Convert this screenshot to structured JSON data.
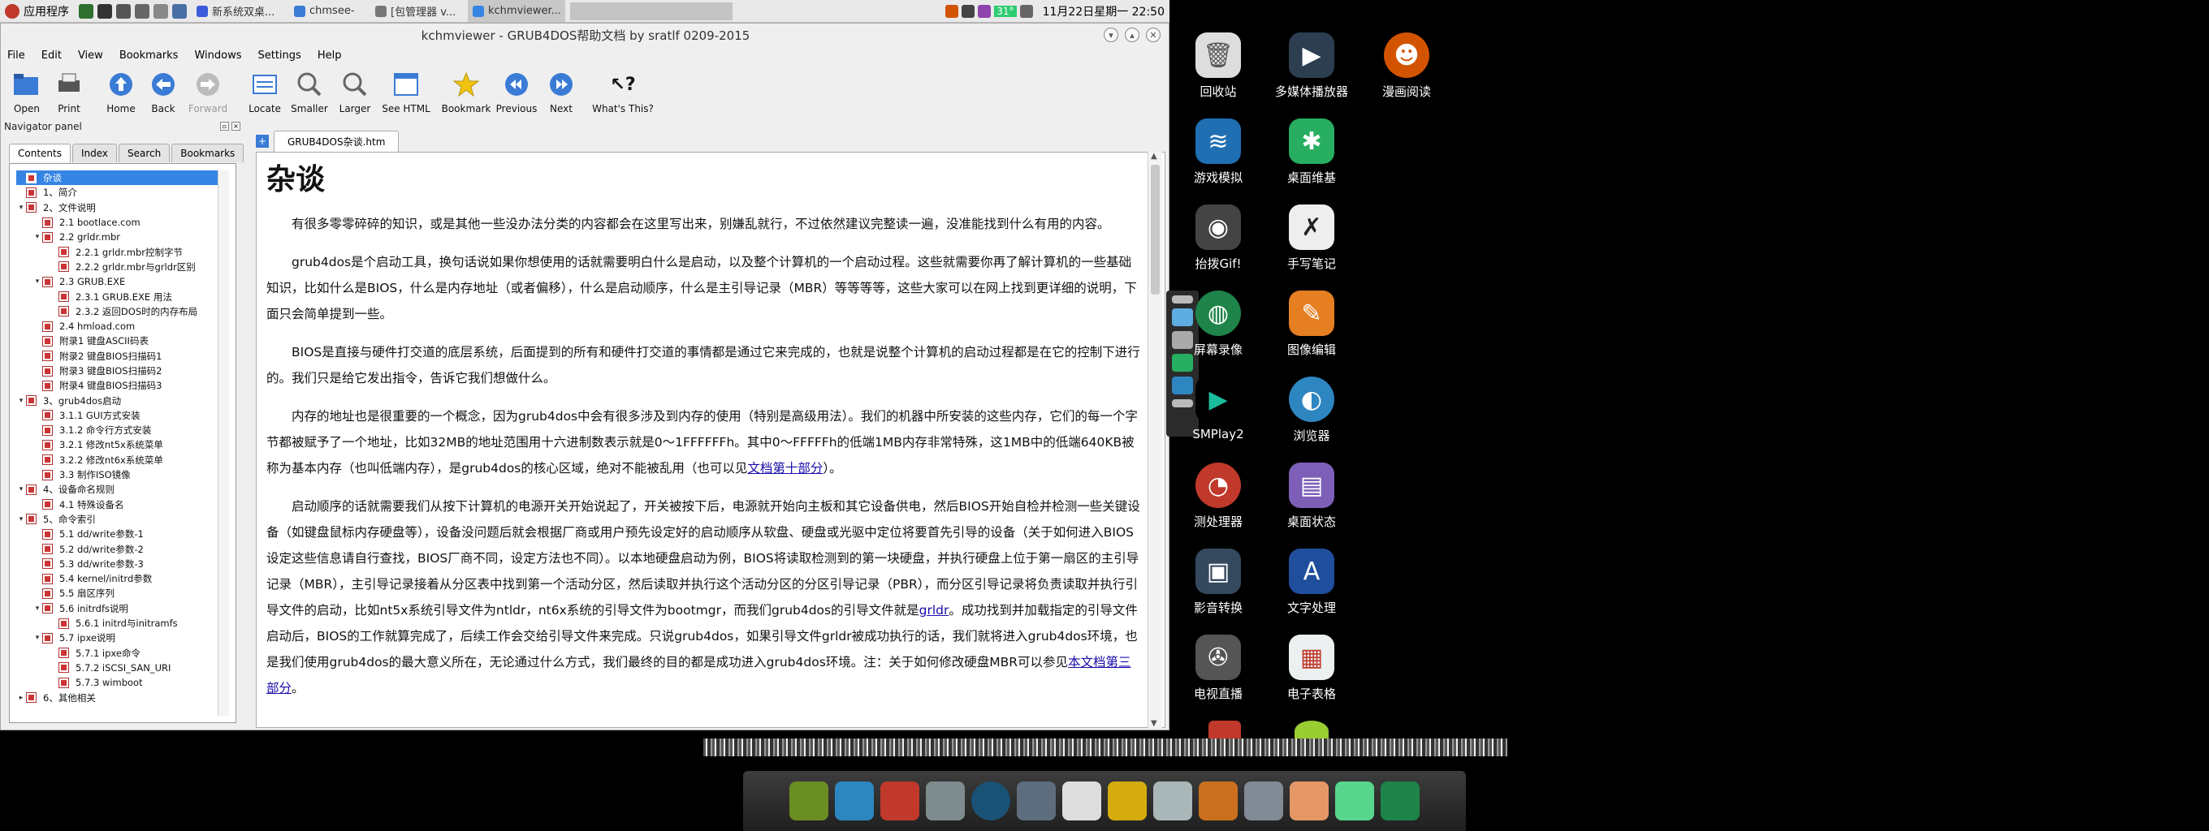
{
  "panel": {
    "app_menu": "应用程序",
    "tasks": [
      "新系统双桌...",
      "chmsee-",
      "[包管理器 v...",
      "kchmviewer..."
    ],
    "tray_battery": "31°",
    "clock": "11月22日星期一 22:50"
  },
  "window": {
    "title": "kchmviewer - GRUB4DOS帮助文档 by sratlf 0209-2015",
    "menu": [
      "File",
      "Edit",
      "View",
      "Bookmarks",
      "Windows",
      "Settings",
      "Help"
    ],
    "toolbar": [
      {
        "label": "Open",
        "icon": "folder-open-icon",
        "enabled": true
      },
      {
        "label": "Print",
        "icon": "printer-icon",
        "enabled": true
      },
      {
        "label": "Home",
        "icon": "home-arrow-icon",
        "enabled": true
      },
      {
        "label": "Back",
        "icon": "back-arrow-icon",
        "enabled": true
      },
      {
        "label": "Forward",
        "icon": "forward-arrow-icon",
        "enabled": false
      },
      {
        "label": "Locate",
        "icon": "locate-icon",
        "enabled": true
      },
      {
        "label": "Smaller",
        "icon": "zoom-out-icon",
        "enabled": true
      },
      {
        "label": "Larger",
        "icon": "zoom-in-icon",
        "enabled": true
      },
      {
        "label": "See HTML",
        "icon": "html-source-icon",
        "enabled": true
      },
      {
        "label": "Bookmark",
        "icon": "star-icon",
        "enabled": true
      },
      {
        "label": "Previous",
        "icon": "previous-icon",
        "enabled": true
      },
      {
        "label": "Next",
        "icon": "next-icon",
        "enabled": true
      },
      {
        "label": "What's This?",
        "icon": "whats-this-icon",
        "enabled": true
      }
    ]
  },
  "navigator": {
    "title": "Navigator panel",
    "tabs": [
      "Contents",
      "Index",
      "Search",
      "Bookmarks"
    ],
    "active_tab": "Contents",
    "tree": [
      {
        "label": "杂谈",
        "level": 0,
        "arrow": "",
        "selected": true
      },
      {
        "label": "1、简介",
        "level": 0,
        "arrow": ""
      },
      {
        "label": "2、文件说明",
        "level": 0,
        "arrow": "▾"
      },
      {
        "label": "2.1 bootlace.com",
        "level": 1,
        "arrow": ""
      },
      {
        "label": "2.2 grldr.mbr",
        "level": 1,
        "arrow": "▾"
      },
      {
        "label": "2.2.1 grldr.mbr控制字节",
        "level": 2,
        "arrow": ""
      },
      {
        "label": "2.2.2 grldr.mbr与grldr区别",
        "level": 2,
        "arrow": ""
      },
      {
        "label": "2.3 GRUB.EXE",
        "level": 1,
        "arrow": "▾"
      },
      {
        "label": "2.3.1 GRUB.EXE 用法",
        "level": 2,
        "arrow": ""
      },
      {
        "label": "2.3.2 返回DOS时的内存布局",
        "level": 2,
        "arrow": ""
      },
      {
        "label": "2.4 hmload.com",
        "level": 1,
        "arrow": ""
      },
      {
        "label": "附录1 键盘ASCII码表",
        "level": 1,
        "arrow": ""
      },
      {
        "label": "附录2 键盘BIOS扫描码1",
        "level": 1,
        "arrow": ""
      },
      {
        "label": "附录3 键盘BIOS扫描码2",
        "level": 1,
        "arrow": ""
      },
      {
        "label": "附录4 键盘BIOS扫描码3",
        "level": 1,
        "arrow": ""
      },
      {
        "label": "3、grub4dos启动",
        "level": 0,
        "arrow": "▾"
      },
      {
        "label": "3.1.1 GUI方式安装",
        "level": 1,
        "arrow": ""
      },
      {
        "label": "3.1.2 命令行方式安装",
        "level": 1,
        "arrow": ""
      },
      {
        "label": "3.2.1 修改nt5x系统菜单",
        "level": 1,
        "arrow": ""
      },
      {
        "label": "3.2.2 修改nt6x系统菜单",
        "level": 1,
        "arrow": ""
      },
      {
        "label": "3.3 制作ISO镜像",
        "level": 1,
        "arrow": ""
      },
      {
        "label": "4、设备命名规则",
        "level": 0,
        "arrow": "▾"
      },
      {
        "label": "4.1 特殊设备名",
        "level": 1,
        "arrow": ""
      },
      {
        "label": "5、命令索引",
        "level": 0,
        "arrow": "▾"
      },
      {
        "label": "5.1 dd/write参数-1",
        "level": 1,
        "arrow": ""
      },
      {
        "label": "5.2 dd/write参数-2",
        "level": 1,
        "arrow": ""
      },
      {
        "label": "5.3 dd/write参数-3",
        "level": 1,
        "arrow": ""
      },
      {
        "label": "5.4 kernel/initrd参数",
        "level": 1,
        "arrow": ""
      },
      {
        "label": "5.5 扇区序列",
        "level": 1,
        "arrow": ""
      },
      {
        "label": "5.6 initrdfs说明",
        "level": 1,
        "arrow": "▾"
      },
      {
        "label": "5.6.1 initrd与initramfs",
        "level": 2,
        "arrow": ""
      },
      {
        "label": "5.7 ipxe说明",
        "level": 1,
        "arrow": "▾"
      },
      {
        "label": "5.7.1 ipxe命令",
        "level": 2,
        "arrow": ""
      },
      {
        "label": "5.7.2 iSCSI_SAN_URI",
        "level": 2,
        "arrow": ""
      },
      {
        "label": "5.7.3 wimboot",
        "level": 2,
        "arrow": ""
      },
      {
        "label": "6、其他相关",
        "level": 0,
        "arrow": "▸"
      }
    ]
  },
  "content": {
    "tab": "GRUB4DOS杂谈.htm",
    "heading": "杂谈",
    "p1": "有很多零零碎碎的知识，或是其他一些没办法分类的内容都会在这里写出来，别嫌乱就行，不过依然建议完整读一遍，没准能找到什么有用的内容。",
    "p2": "grub4dos是个启动工具，换句话说如果你想使用的话就需要明白什么是启动，以及整个计算机的一个启动过程。这些就需要你再了解计算机的一些基础知识，比如什么是BIOS，什么是内存地址（或者偏移），什么是启动顺序，什么是主引导记录（MBR）等等等等，这些大家可以在网上找到更详细的说明，下面只会简单提到一些。",
    "p3": "BIOS是直接与硬件打交道的底层系统，后面提到的所有和硬件打交道的事情都是通过它来完成的，也就是说整个计算机的启动过程都是在它的控制下进行的。我们只是给它发出指令，告诉它我们想做什么。",
    "p4_pre": "内存的地址也是很重要的一个概念，因为grub4dos中会有很多涉及到内存的使用（特别是高级用法）。我们的机器中所安装的这些内存，它们的每一个字节都被赋予了一个地址，比如32MB的地址范围用十六进制数表示就是0～1FFFFFFh。其中0～FFFFFh的低端1MB内存非常特殊，这1MB中的低端640KB被称为基本内存（也叫低端内存），是grub4dos的核心区域，绝对不能被乱用（也可以见",
    "p4_link": "文档第十部分",
    "p4_post": "）。",
    "p5_pre": "启动顺序的话就需要我们从按下计算机的电源开关开始说起了，开关被按下后，电源就开始向主板和其它设备供电，然后BIOS开始自检并检测一些关键设备（如键盘鼠标内存硬盘等），设备没问题后就会根据厂商或用户预先设定好的启动顺序从软盘、硬盘或光驱中定位将要首先引导的设备（关于如何进入BIOS设定这些信息请自行查找，BIOS厂商不同，设定方法也不同）。以本地硬盘启动为例，BIOS将读取检测到的第一块硬盘，并执行硬盘上位于第一扇区的主引导记录（MBR），主引导记录接着从分区表中找到第一个活动分区，然后读取并执行这个活动分区的分区引导记录（PBR），而分区引导记录将负责读取并执行引导文件的启动，比如nt5x系统引导文件为ntldr，nt6x系统的引导文件为bootmgr，而我们grub4dos的引导文件就是",
    "p5_link": "grldr",
    "p5_post": "。成功找到并加载指定的引导文件启动后，BIOS的工作就算完成了，后续工作会交给引导文件来完成。只说grub4dos，如果引导文件grldr被成功执行的话，我们就将进入grub4dos环境，也是我们使用grub4dos的最大意义所在，无论通过什么方式，我们最终的目的都是成功进入grub4dos环境。注：关于如何修改硬盘MBR可以参见",
    "p5_link2": "本文档第三部分",
    "p5_post2": "。"
  },
  "desktop": {
    "col1": [
      "回收站",
      "游戏模拟",
      "抬拨Gif!",
      "屏幕录像",
      "SMPlay2",
      "测处理器",
      "影音转换",
      "电视直播"
    ],
    "col2": [
      "多媒体播放器",
      "桌面维基",
      "手写笔记",
      "图像编辑",
      "浏览器",
      "桌面状态",
      "文字处理",
      "电子表格"
    ],
    "col3": [
      "漫画阅读"
    ]
  },
  "colors": {
    "selection": "#3584e4",
    "link": "#1a0dab",
    "panel_bg": "#e9e9e9"
  }
}
